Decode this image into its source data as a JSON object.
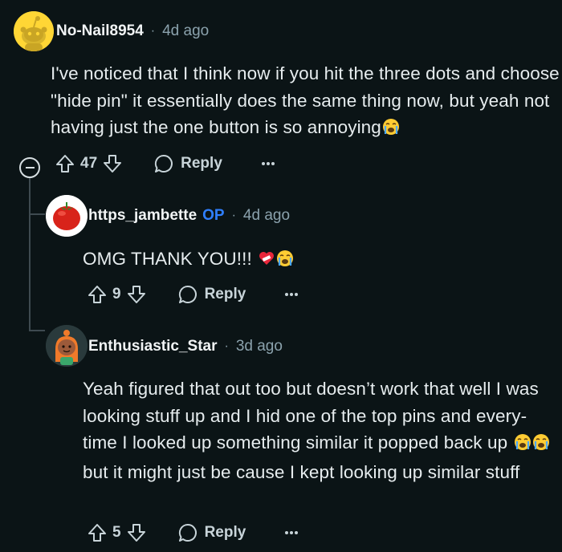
{
  "comments": [
    {
      "username": "No-Nail8954",
      "separator": "·",
      "timestamp": "4d ago",
      "body": "I've noticed that I think now if you hit the three dots and choose \"hide pin\" it essentially does the same thing now, but yeah not having just the one button is so annoying",
      "votes": "47",
      "reply_label": "Reply",
      "trailing_emoji": "loudly-crying-face"
    },
    {
      "username": "https_jambette",
      "op_badge": "OP",
      "separator": "·",
      "timestamp": "4d ago",
      "body": "OMG THANK YOU!!!",
      "votes": "9",
      "reply_label": "Reply",
      "trailing_emoji": [
        "mending-heart",
        "loudly-crying-face"
      ]
    },
    {
      "username": "Enthusiastic_Star",
      "separator": "·",
      "timestamp": "3d ago",
      "body_part1": "Yeah figured that out too but doesn’t work that well I was looking stuff up and I hid one of the top pins and every-time I looked up something similar it popped back up ",
      "body_part2": "but it might just be cause I kept looking up similar stuff",
      "votes": "5",
      "reply_label": "Reply",
      "inline_emoji": [
        "loudly-crying-face",
        "loudly-crying-face"
      ]
    }
  ],
  "colors": {
    "background": "#0b1416",
    "text": "#e6ecee",
    "muted": "#8ba2ad",
    "op_blue": "#2f7fff",
    "thread_line": "#3e4a50",
    "avatar_yellow": "#ffd635"
  }
}
